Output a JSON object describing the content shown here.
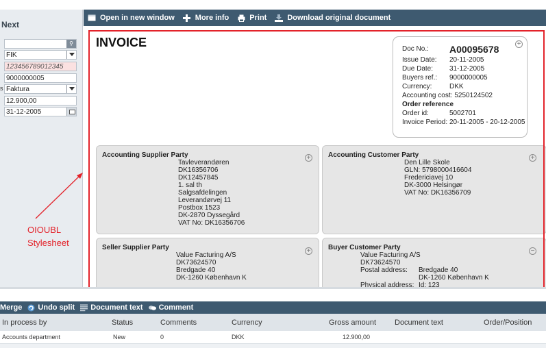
{
  "left_panel": {
    "header": "Next",
    "fields": [
      {
        "value": ""
      },
      {
        "value": "FIK"
      },
      {
        "value": "123456789012345"
      },
      {
        "value": "9000000005"
      },
      {
        "value": "Faktura"
      },
      {
        "value": "12.900,00"
      },
      {
        "value": "31-12-2005"
      }
    ],
    "cut_label": "s"
  },
  "toolbar": {
    "open_new_window": "Open in new window",
    "more_info": "More info",
    "print": "Print",
    "download": "Download original document"
  },
  "invoice": {
    "title": "INVOICE",
    "doc_no_label": "Doc No.:",
    "doc_no": "A00095678",
    "issue_date_label": "Issue Date:",
    "issue_date": "20-11-2005",
    "due_date_label": "Due Date:",
    "due_date": "31-12-2005",
    "buyers_ref_label": "Buyers ref.:",
    "buyers_ref": "9000000005",
    "currency_label": "Currency:",
    "currency": "DKK",
    "accounting_cost_label": "Accounting cost:",
    "accounting_cost": "5250124502",
    "order_reference_label": "Order reference",
    "order_id_label": "Order id:",
    "order_id": "5002701",
    "invoice_period_label": "Invoice Period:",
    "invoice_period": "20-11-2005 - 20-12-2005",
    "accounting_supplier": {
      "title": "Accounting Supplier Party",
      "lines": [
        "Tavleverandøren",
        "DK16356706",
        "DK12457845",
        "1. sal th",
        "Salgsafdelingen",
        "Leverandørvej 11",
        "Postbox 1523",
        "DK-2870 Dyssegård",
        "VAT No: DK16356706"
      ]
    },
    "accounting_customer": {
      "title": "Accounting Customer Party",
      "lines": [
        "Den Lille Skole",
        "GLN: 5798000416604",
        "Fredericiavej 10",
        "DK-3000 Helsingør",
        "VAT No: DK16356709"
      ]
    },
    "seller_supplier": {
      "title": "Seller Supplier Party",
      "lines": [
        "Value Facturing A/S",
        "DK73624570",
        "Bredgade 40",
        "DK-1260 København K"
      ]
    },
    "buyer_customer": {
      "title": "Buyer Customer Party",
      "lines": [
        "Value Facturing A/S",
        "DK73624570"
      ],
      "postal_label": "Postal address:",
      "postal_lines": [
        "Bredgade 40",
        "DK-1260 København K"
      ],
      "physical_label": "Physical address:",
      "physical_value": "Id: 123"
    }
  },
  "annotation": {
    "line1": "OIOUBL",
    "line2": "Stylesheet"
  },
  "bottom_toolbar": {
    "merge": "Merge",
    "undo_split": "Undo split",
    "document_text": "Document text",
    "comment": "Comment"
  },
  "grid": {
    "columns": [
      "In process by",
      "Status",
      "Comments",
      "Currency",
      "Gross amount",
      "Document text",
      "Order/Position"
    ],
    "rows": [
      {
        "in_process_by": "Accounts department",
        "status": "New",
        "comments": "0",
        "currency": "DKK",
        "gross_amount": "12.900,00",
        "document_text": "",
        "order_position": ""
      }
    ]
  },
  "colors": {
    "toolbar": "#3e5a70",
    "annotation": "#e3222a",
    "party_bg": "#e6e6e6"
  }
}
